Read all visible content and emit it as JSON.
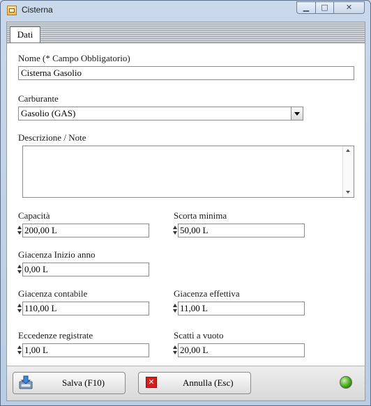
{
  "window": {
    "title": "Cisterna",
    "min_glyph": "▁",
    "max_glyph": "□",
    "close_glyph": "✕"
  },
  "tabs": [
    {
      "label": "Dati"
    }
  ],
  "form": {
    "nome": {
      "label": "Nome (* Campo Obbligatorio)",
      "value": "Cisterna Gasolio"
    },
    "carburante": {
      "label": "Carburante",
      "value": "Gasolio (GAS)"
    },
    "descrizione": {
      "label": "Descrizione / Note",
      "value": ""
    },
    "capacita": {
      "label": "Capacità",
      "value": "200,00 L"
    },
    "scorta_minima": {
      "label": "Scorta minima",
      "value": "50,00 L"
    },
    "giacenza_inizio": {
      "label": "Giacenza Inizio anno",
      "value": "0,00 L"
    },
    "giacenza_contabile": {
      "label": "Giacenza contabile",
      "value": "110,00 L"
    },
    "giacenza_effettiva": {
      "label": "Giacenza effettiva",
      "value": "11,00 L"
    },
    "eccedenze": {
      "label": "Eccedenze registrate",
      "value": "1,00 L"
    },
    "scatti_vuoto": {
      "label": "Scatti a vuoto",
      "value": "20,00 L"
    }
  },
  "footer": {
    "save_label": "Salva (F10)",
    "cancel_label": "Annulla (Esc)",
    "cancel_icon_glyph": "✕",
    "status_color": "#47a71e"
  }
}
